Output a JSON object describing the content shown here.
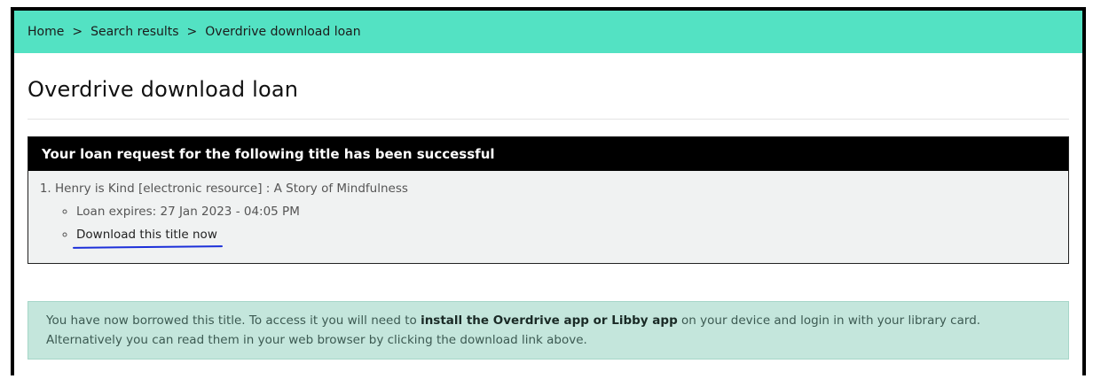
{
  "breadcrumb": {
    "items": [
      "Home",
      "Search results",
      "Overdrive download loan"
    ],
    "separator": ">"
  },
  "page": {
    "title": "Overdrive download loan"
  },
  "panel": {
    "header": "Your loan request for the following title has been successful",
    "items": [
      {
        "number": "1.",
        "title": "Henry is Kind [electronic resource] : A Story of Mindfulness",
        "loan_expires": "Loan expires: 27 Jan 2023 - 04:05 PM",
        "download_label": "Download this title now"
      }
    ]
  },
  "notice": {
    "text_before": "You have now borrowed this title. To access it you will need to ",
    "bold": "install the Overdrive app or Libby app",
    "text_after": " on your device and login in with your library card.",
    "line2": "Alternatively you can read them in your web browser by clicking the download link above."
  },
  "colors": {
    "breadcrumb_bg": "#53e2c3",
    "panel_header_bg": "#000000",
    "panel_bg": "#f0f2f2",
    "alert_bg": "#c4e6dc",
    "annotation_underline": "#1b2fd9"
  }
}
